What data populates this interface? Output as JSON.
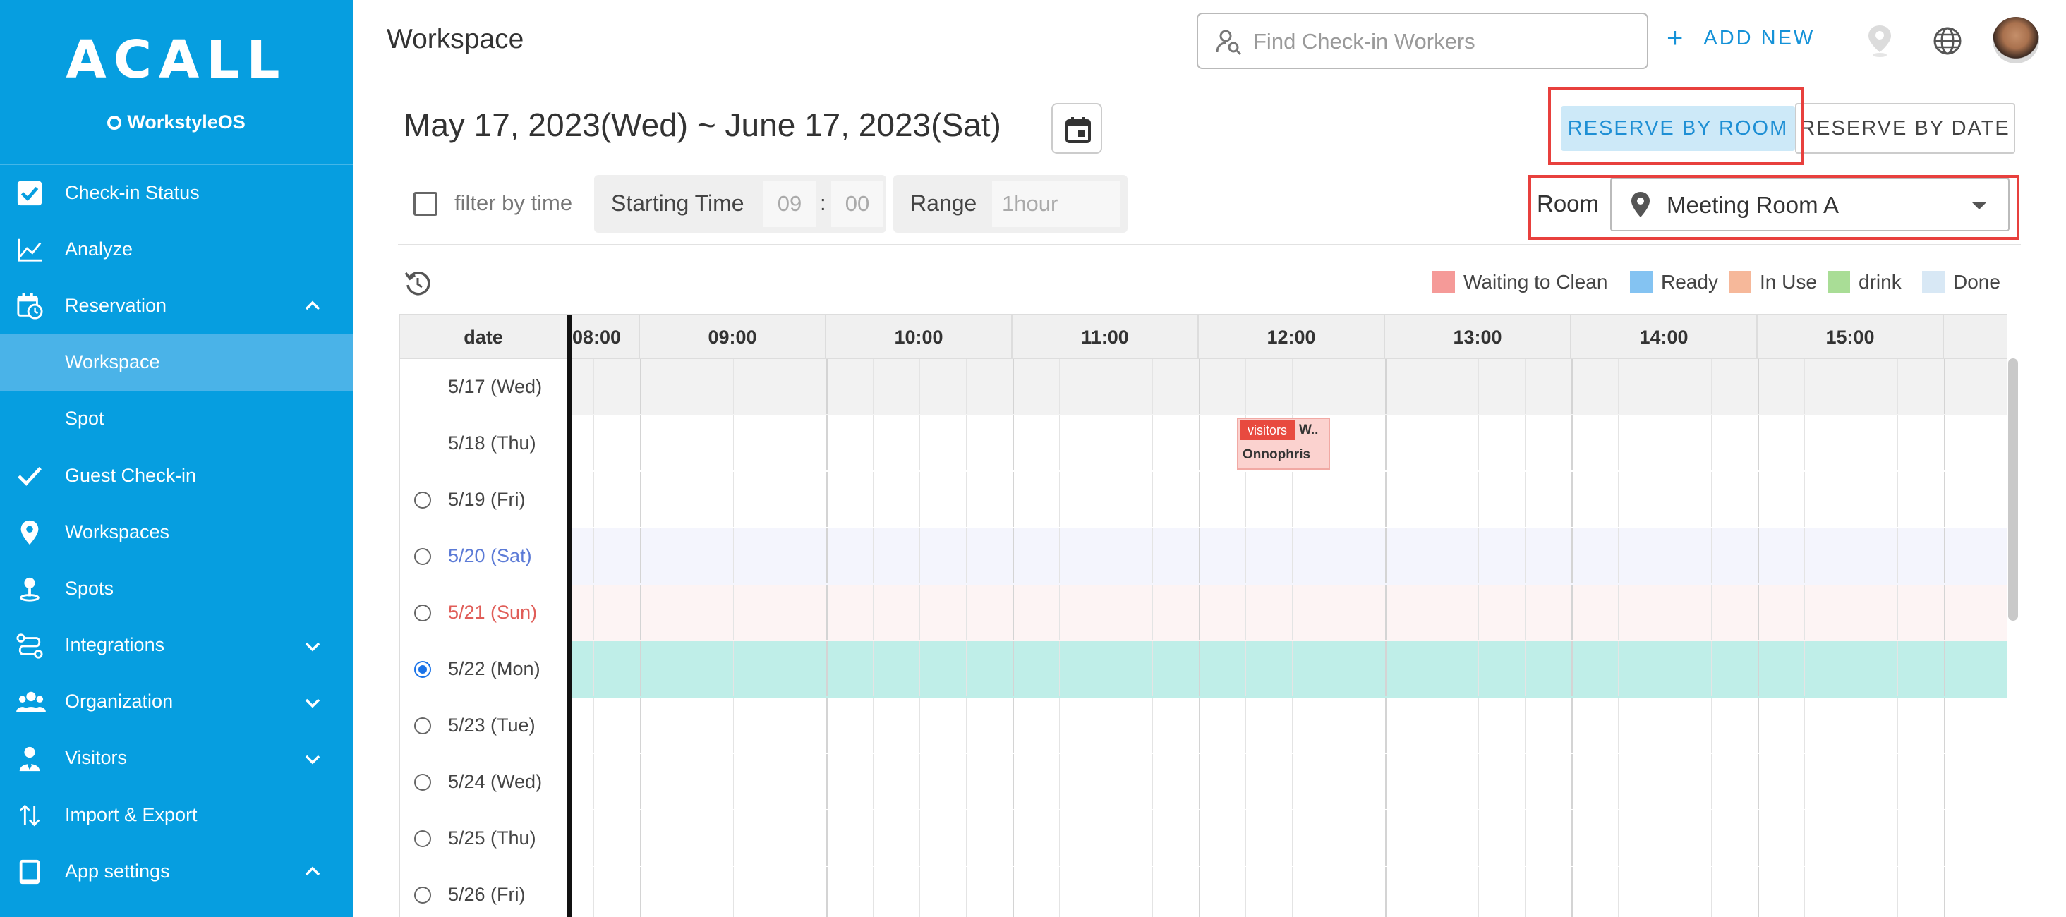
{
  "sidebar": {
    "logo": "ACALL",
    "product": "WorkstyleOS",
    "items": [
      {
        "label": "Check-in Status",
        "icon": "checkbox-icon"
      },
      {
        "label": "Analyze",
        "icon": "chart-line-icon"
      },
      {
        "label": "Reservation",
        "icon": "calendar-clock-icon",
        "expanded": true
      },
      {
        "label": "Workspace",
        "sub": true,
        "active": true
      },
      {
        "label": "Spot",
        "sub": true
      },
      {
        "label": "Guest Check-in",
        "icon": "check-icon"
      },
      {
        "label": "Workspaces",
        "icon": "location-pin-icon"
      },
      {
        "label": "Spots",
        "icon": "person-pin-icon"
      },
      {
        "label": "Integrations",
        "icon": "route-icon",
        "expanded": false
      },
      {
        "label": "Organization",
        "icon": "people-icon",
        "expanded": false
      },
      {
        "label": "Visitors",
        "icon": "visitor-icon",
        "expanded": false
      },
      {
        "label": "Import & Export",
        "icon": "swap-vertical-icon"
      },
      {
        "label": "App settings",
        "icon": "tablet-icon",
        "expanded": true
      }
    ]
  },
  "header": {
    "title": "Workspace",
    "search_placeholder": "Find Check-in Workers",
    "add_new_label": "ADD NEW"
  },
  "date_range": "May 17, 2023(Wed) ~ June 17, 2023(Sat)",
  "mode": {
    "reserve_by_room": "RESERVE BY ROOM",
    "reserve_by_date": "RESERVE BY DATE",
    "selected": "reserve_by_room"
  },
  "filter": {
    "filter_by_time_label": "filter by time",
    "filter_by_time_checked": false,
    "starting_time_label": "Starting Time",
    "start_hour": "09",
    "start_minute": "00",
    "range_label": "Range",
    "range_value": "1hour",
    "room_label": "Room",
    "room_value": "Meeting Room A"
  },
  "legend": [
    {
      "label": "Waiting to Clean",
      "color": "#f59a98"
    },
    {
      "label": "Ready",
      "color": "#84c3f2"
    },
    {
      "label": "In Use",
      "color": "#f6b89a"
    },
    {
      "label": "drink",
      "color": "#a9dd96"
    },
    {
      "label": "Done",
      "color": "#d8e8f5"
    }
  ],
  "grid": {
    "date_header": "date",
    "hours": [
      "08:00",
      "09:00",
      "10:00",
      "11:00",
      "12:00",
      "13:00",
      "14:00",
      "15:00"
    ],
    "rows": [
      {
        "label": "5/17 (Wed)",
        "radio": false,
        "bg": "#f2f2f2",
        "label_color": "#444444"
      },
      {
        "label": "5/18 (Thu)",
        "radio": false,
        "bg": "#ffffff",
        "label_color": "#444444"
      },
      {
        "label": "5/19 (Fri)",
        "radio": true,
        "selected": false,
        "bg": "#ffffff",
        "label_color": "#444444"
      },
      {
        "label": "5/20 (Sat)",
        "radio": true,
        "selected": false,
        "bg": "#f4f5fd",
        "label_color": "#5b7ad6"
      },
      {
        "label": "5/21 (Sun)",
        "radio": true,
        "selected": false,
        "bg": "#fdf4f4",
        "label_color": "#e05d58"
      },
      {
        "label": "5/22 (Mon)",
        "radio": true,
        "selected": true,
        "bg": "#bfeee8",
        "label_color": "#444444"
      },
      {
        "label": "5/23 (Tue)",
        "radio": true,
        "selected": false,
        "bg": "#ffffff",
        "label_color": "#444444"
      },
      {
        "label": "5/24 (Wed)",
        "radio": true,
        "selected": false,
        "bg": "#ffffff",
        "label_color": "#444444"
      },
      {
        "label": "5/25 (Thu)",
        "radio": true,
        "selected": false,
        "bg": "#ffffff",
        "label_color": "#444444"
      },
      {
        "label": "5/26 (Fri)",
        "radio": true,
        "selected": false,
        "bg": "#ffffff",
        "label_color": "#444444"
      }
    ],
    "booking": {
      "tag": "visitors",
      "who": "W..",
      "name": "Onnophris"
    }
  }
}
